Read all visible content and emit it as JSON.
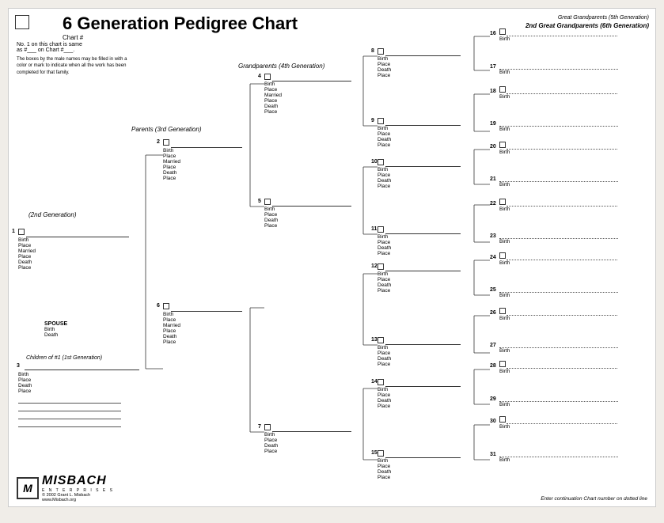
{
  "title": "6 Generation Pedigree Chart",
  "chartNum": "Chart #",
  "instructions": {
    "line1": "No. 1 on this chart is same",
    "line2": "as #___ on Chart #___.",
    "note": "The boxes by the male names may be filled in with a color or mark to indicate when all the work has been completed for that family."
  },
  "generationLabels": {
    "gen2": "(2nd Generation)",
    "gen3": "Parents (3rd Generation)",
    "gen4": "Grandparents (4th Generation)",
    "gen5": "Great Grandparents (5th Generation)",
    "gen6": "2nd Great Grandparents (6th Generation)"
  },
  "fields": {
    "birth": "Birth",
    "place": "Place",
    "married": "Married",
    "death": "Death",
    "deathShort": "Death"
  },
  "persons": {
    "p1": {
      "num": "1",
      "labels": [
        "Birth",
        "Place",
        "Married",
        "Place",
        "Death",
        "Place"
      ]
    },
    "p2": {
      "num": "2",
      "labels": [
        "Birth",
        "Place",
        "Married",
        "Place",
        "Death",
        "Place"
      ]
    },
    "p3": {
      "num": "3",
      "labels": [
        "Birth",
        "Place",
        "Death",
        "Place"
      ]
    },
    "p4": {
      "num": "4",
      "labels": [
        "Birth",
        "Place",
        "Married",
        "Place",
        "Death",
        "Place"
      ]
    },
    "p5": {
      "num": "5",
      "labels": [
        "Birth",
        "Place",
        "Death",
        "Place"
      ]
    },
    "p6": {
      "num": "6",
      "labels": [
        "Birth",
        "Place",
        "Married",
        "Place",
        "Death",
        "Place"
      ]
    },
    "p7": {
      "num": "7",
      "labels": [
        "Birth",
        "Place",
        "Death",
        "Place"
      ]
    },
    "p8": {
      "num": "8",
      "labels": [
        "Birth",
        "Place",
        "Death",
        "Place"
      ]
    },
    "p9": {
      "num": "9",
      "labels": [
        "Birth",
        "Place",
        "Death",
        "Place"
      ]
    },
    "p10": {
      "num": "10",
      "labels": [
        "Birth",
        "Place",
        "Death",
        "Place"
      ]
    },
    "p11": {
      "num": "11",
      "labels": [
        "Birth",
        "Place",
        "Death",
        "Place"
      ]
    },
    "p12": {
      "num": "12",
      "labels": [
        "Birth",
        "Place",
        "Death",
        "Place"
      ]
    },
    "p13": {
      "num": "13",
      "labels": [
        "Birth",
        "Place",
        "Death",
        "Place"
      ]
    },
    "p14": {
      "num": "14",
      "labels": [
        "Birth",
        "Place",
        "Death",
        "Place"
      ]
    },
    "p15": {
      "num": "15",
      "labels": [
        "Birth",
        "Place",
        "Death",
        "Place"
      ]
    },
    "p16": {
      "num": "16"
    },
    "p17": {
      "num": "17"
    },
    "p18": {
      "num": "18"
    },
    "p19": {
      "num": "19"
    },
    "p20": {
      "num": "20"
    },
    "p21": {
      "num": "21"
    },
    "p22": {
      "num": "22"
    },
    "p23": {
      "num": "23"
    },
    "p24": {
      "num": "24"
    },
    "p25": {
      "num": "25"
    },
    "p26": {
      "num": "26"
    },
    "p27": {
      "num": "27"
    },
    "p28": {
      "num": "28"
    },
    "p29": {
      "num": "29"
    },
    "p30": {
      "num": "30"
    },
    "p31": {
      "num": "31"
    }
  },
  "spouse": {
    "label": "SPOUSE",
    "fields": [
      "Birth",
      "Death"
    ]
  },
  "children": {
    "label": "Children of #1 (1st Generation)"
  },
  "continuation": "Enter continuation Chart\nnumber on dotted line",
  "logo": {
    "name": "MISBACH",
    "enterprises": "E N T E R P R I S E S",
    "copyright": "© 2002 Grant L. Misbach",
    "website": "www.Misbach.org"
  }
}
